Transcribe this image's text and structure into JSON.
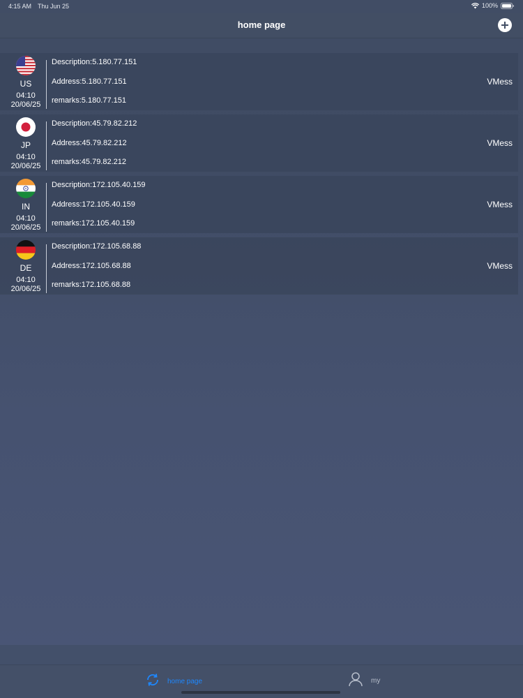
{
  "status_bar": {
    "time": "4:15 AM",
    "date": "Thu Jun 25",
    "battery": "100%",
    "icons": [
      "wifi-icon",
      "battery-icon"
    ]
  },
  "nav": {
    "title": "home page",
    "add_icon": "plus-circle-icon"
  },
  "servers": [
    {
      "country": "US",
      "flag_icon": "us-flag-icon",
      "time": "04:10",
      "date": "20/06/25",
      "description": "Description:5.180.77.151",
      "address": "Address:5.180.77.151",
      "remarks": "remarks:5.180.77.151",
      "protocol": "VMess"
    },
    {
      "country": "JP",
      "flag_icon": "jp-flag-icon",
      "time": "04:10",
      "date": "20/06/25",
      "description": "Description:45.79.82.212",
      "address": "Address:45.79.82.212",
      "remarks": "remarks:45.79.82.212",
      "protocol": "VMess"
    },
    {
      "country": "IN",
      "flag_icon": "in-flag-icon",
      "time": "04:10",
      "date": "20/06/25",
      "description": "Description:172.105.40.159",
      "address": "Address:172.105.40.159",
      "remarks": "remarks:172.105.40.159",
      "protocol": "VMess"
    },
    {
      "country": "DE",
      "flag_icon": "de-flag-icon",
      "time": "04:10",
      "date": "20/06/25",
      "description": "Description:172.105.68.88",
      "address": "Address:172.105.68.88",
      "remarks": "remarks:172.105.68.88",
      "protocol": "VMess"
    }
  ],
  "tabs": [
    {
      "label": "home page",
      "icon": "refresh-icon",
      "active": true
    },
    {
      "label": "my",
      "icon": "person-icon",
      "active": false
    }
  ],
  "colors": {
    "background": "#414d65",
    "row": "#3a455c",
    "accent": "#1e88ff"
  }
}
